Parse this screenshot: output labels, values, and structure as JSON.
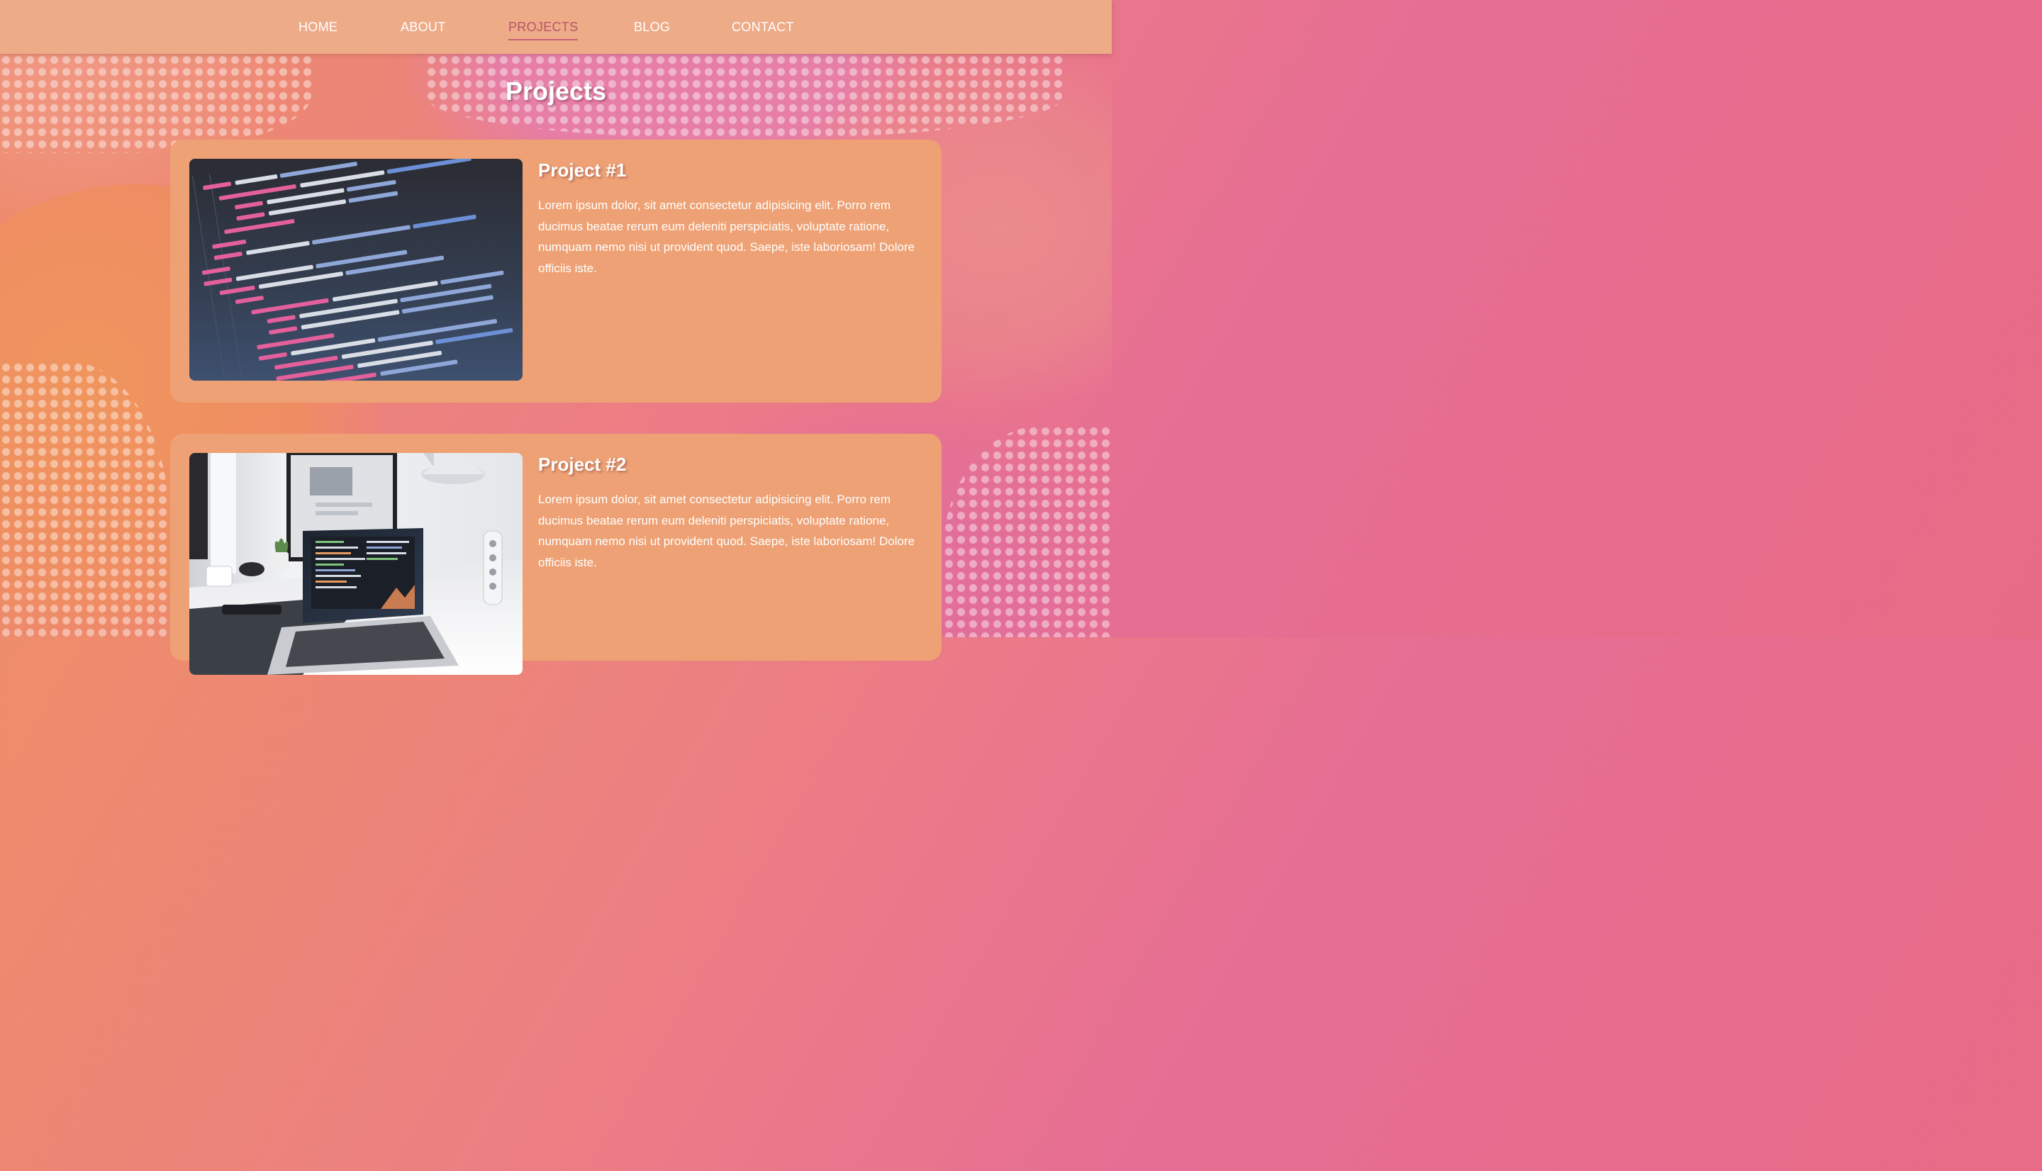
{
  "nav": {
    "items": [
      {
        "label": "HOME",
        "active": false
      },
      {
        "label": "ABOUT",
        "active": false
      },
      {
        "label": "PROJECTS",
        "active": true
      },
      {
        "label": "BLOG",
        "active": false
      },
      {
        "label": "CONTACT",
        "active": false
      }
    ]
  },
  "page": {
    "title": "Projects"
  },
  "projects": [
    {
      "title": "Project #1",
      "description": "Lorem ipsum dolor, sit amet consectetur adipisicing elit. Porro rem ducimus beatae rerum eum deleniti perspiciatis, voluptate ratione, numquam nemo nisi ut provident quod. Saepe, iste laboriosam! Dolore officiis iste.",
      "image": "code-editor-screen-photo"
    },
    {
      "title": "Project #2",
      "description": "Lorem ipsum dolor, sit amet consectetur adipisicing elit. Porro rem ducimus beatae rerum eum deleniti perspiciatis, voluptate ratione, numquam nemo nisi ut provident quod. Saepe, iste laboriosam! Dolore officiis iste.",
      "image": "laptop-desk-photo"
    }
  ],
  "colors": {
    "nav_background": "#eeab88",
    "nav_active": "#b5566a",
    "card_background": "#eea174",
    "text": "#ffffff"
  }
}
